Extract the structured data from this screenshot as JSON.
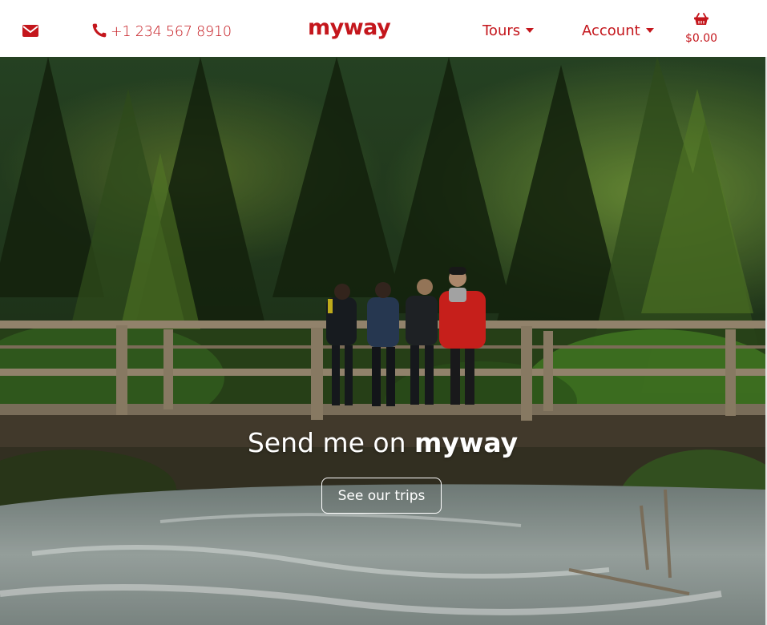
{
  "header": {
    "phone": "+1 234 567 8910",
    "brand": "myway",
    "nav": [
      {
        "label": "Tours"
      },
      {
        "label": "Account"
      }
    ],
    "cart_total": "$0.00",
    "icons": {
      "mail": "envelope-icon",
      "phone": "phone-icon",
      "cart": "basket-icon"
    }
  },
  "hero": {
    "title_prefix": "Send me on",
    "title_brand": "myway",
    "cta_label": "See our trips"
  },
  "colors": {
    "brand_red": "#c4161c",
    "white": "#ffffff"
  }
}
